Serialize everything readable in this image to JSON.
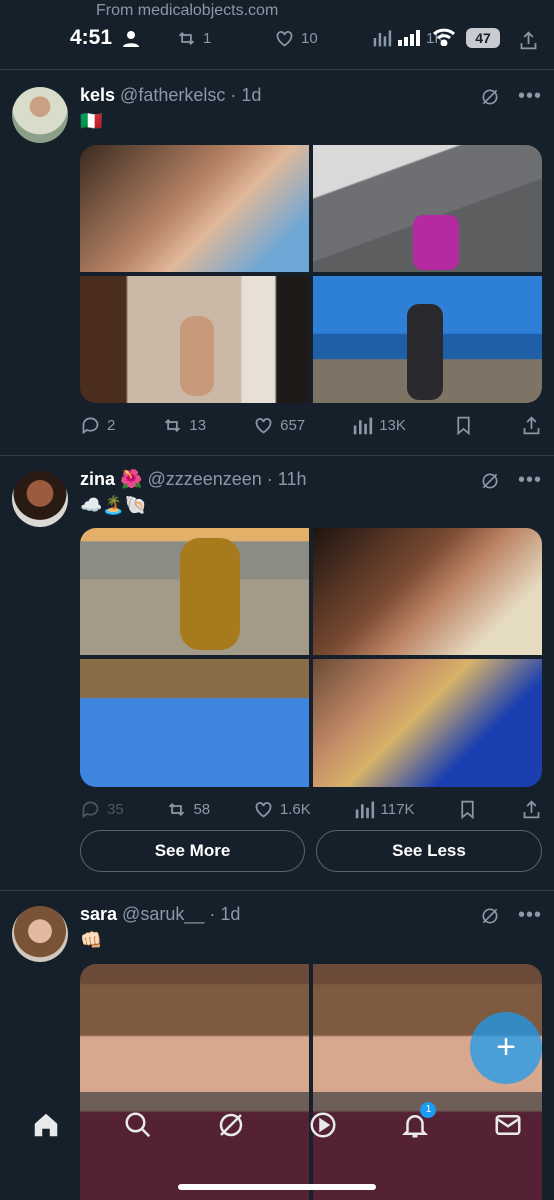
{
  "status": {
    "from_label": "From medicalobjects.com",
    "time": "4:51",
    "retweets": "1",
    "likes": "10",
    "views": "1K",
    "battery": "47"
  },
  "tweets": [
    {
      "name": "kels",
      "handle": "@fatherkelsc",
      "sep": "·",
      "time": "1d",
      "text": "🇮🇹",
      "replies": "2",
      "retweets": "13",
      "likes": "657",
      "views": "13K"
    },
    {
      "name": "zina",
      "name_emoji": "🌺",
      "handle": "@zzzeenzeen",
      "sep": "·",
      "time": "11h",
      "text": "☁️🏝️🐚",
      "replies": "35",
      "retweets": "58",
      "likes": "1.6K",
      "views": "117K"
    },
    {
      "name": "sara",
      "handle": "@saruk__",
      "sep": "·",
      "time": "1d",
      "text": "👊🏻"
    }
  ],
  "buttons": {
    "see_more": "See More",
    "see_less": "See Less"
  },
  "fab_symbol": "+",
  "nav": {
    "items": [
      "home-icon",
      "search-icon",
      "grok-icon",
      "video-icon",
      "notifications-icon",
      "messages-icon"
    ],
    "notification_count": "1"
  },
  "colors": {
    "background": "#15202b",
    "accent": "#1d9bf0",
    "muted": "#8b98a5"
  }
}
